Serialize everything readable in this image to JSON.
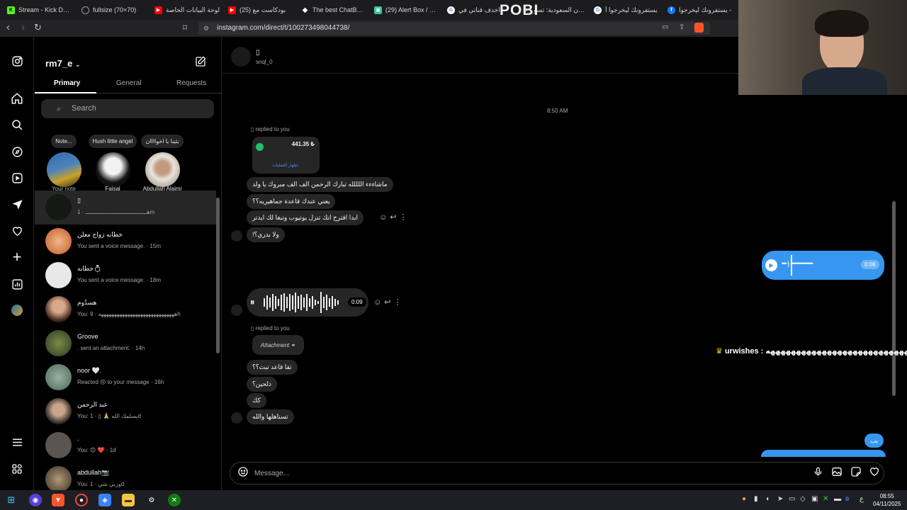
{
  "browser": {
    "tabs": [
      {
        "label": "Stream - Kick Dashb",
        "icon": "kick-icon",
        "color": "#53fc18"
      },
      {
        "label": "fullsize (70×70)",
        "icon": "globe-icon",
        "color": "#888888"
      },
      {
        "label": "لوحة البيانات الخاصة",
        "icon": "youtube-icon",
        "color": "#ff0000"
      },
      {
        "label": "(25) بودكاست مع",
        "icon": "youtube-icon",
        "color": "#ff0000"
      },
      {
        "label": "The best ChatBot a",
        "icon": "bot-icon",
        "color": "#ffffff"
      },
      {
        "label": "(29) Alert Box / Stre",
        "icon": "alert-icon",
        "color": "#31c3a2"
      },
      {
        "label": "اخدف قناتي في",
        "icon": "google-icon",
        "color": "#ffffff"
      },
      {
        "label": "أمازون السعودية: تسو",
        "icon": "amazon-icon",
        "color": "#ff9900"
      },
      {
        "label": "يستفرونك ليخرجوا أ",
        "icon": "google-icon",
        "color": "#ffffff"
      },
      {
        "label": "يستفرونك ليخرجوا -",
        "icon": "facebook-icon",
        "color": "#1877f2"
      }
    ],
    "overlay_text": "POBI",
    "url": "instagram.com/direct/t/100273498044738/"
  },
  "rail": {
    "items": [
      "instagram-logo-icon",
      "home-icon",
      "search-icon",
      "explore-icon",
      "reels-icon",
      "messages-icon",
      "heart-icon",
      "create-icon",
      "dashboard-icon",
      "profile-icon",
      "menu-icon",
      "meta-icon"
    ]
  },
  "inbox": {
    "username": "rm7_e",
    "tabs": [
      "Primary",
      "General",
      "Requests"
    ],
    "search_placeholder": "Search",
    "notes": [
      {
        "bubble": "Note...",
        "name": "Your note"
      },
      {
        "bubble": "Hush little angel",
        "name": "Faisal"
      },
      {
        "bubble": "بثينا يا اخواااان",
        "name": "Abdullah Alajmi"
      }
    ],
    "conversations": [
      {
        "name": "▯",
        "sub": "هـــــــــــــــــــــــــــــــــــــ · 1m",
        "active": true
      },
      {
        "name": "خطابه زواج معلن",
        "sub": "You sent a voice message. · 15m"
      },
      {
        "name": "خطابه💍",
        "sub": "You sent a voice message. · 18m"
      },
      {
        "name": "هسدُوم",
        "sub": "You: هههههههههههههههههههههههههههههه · 9h"
      },
      {
        "name": "Groove",
        "sub": ". sent an attachment. · 14h"
      },
      {
        "name": "noor 🤍.",
        "sub": "Reacted 😢 to your message · 16h"
      },
      {
        "name": "عبد الرحمن",
        "sub": "You: يسلمك الله 🙏 ▯ · 1d"
      },
      {
        "name": ".",
        "sub": "You: 😊 ❤️ · 1d"
      },
      {
        "name": "abdullah📷",
        "sub": "You: وربي شي · 1d"
      }
    ]
  },
  "chat": {
    "header": {
      "name": "▯",
      "handle": "snql_0"
    },
    "timestamp": "8:50 AM",
    "replied_label": "▯ replied to you",
    "reply_card": {
      "amount": "441.35 ₺",
      "link": "اظهار العمليات"
    },
    "messages_group1": [
      "ماشاءءء اللللله تبارك الرحمن الف الف مبروك يا ولد",
      "يعني عندك قاعدة جماهيريه؟؟",
      "ابدا اقترح انك تنزل يوتيوب وتبغا لك ايدتر",
      "ولا بدري؟!"
    ],
    "voice_sent_duration": "0:08",
    "voice_recv_duration": "0:09",
    "attachment_label": "Attachment",
    "messages_group2": [
      "تقا قاعد تبث؟؟",
      "ذلحين؟",
      "كك",
      "تستاهلها والله"
    ],
    "sent_small": "يب",
    "composer_placeholder": "Message..."
  },
  "stream_overlay": {
    "text": "urwishes : هههههههههههههههههههههههههههههه"
  },
  "taskbar": {
    "time": "08:55",
    "date": "04/11/2025",
    "lang": "ع"
  }
}
